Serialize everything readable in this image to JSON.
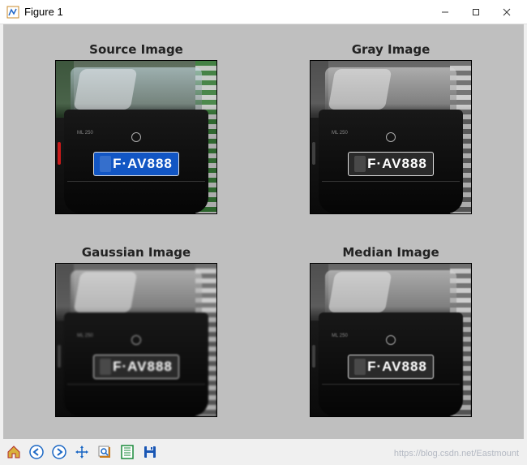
{
  "window": {
    "title": "Figure 1"
  },
  "subplots": [
    {
      "title": "Source Image",
      "mode": "color",
      "plate_text": "F·AV888",
      "badge": "ML 250"
    },
    {
      "title": "Gray Image",
      "mode": "gray",
      "plate_text": "F·AV888",
      "badge": "ML 250"
    },
    {
      "title": "Gaussian Image",
      "mode": "gauss",
      "plate_text": "F·AV888",
      "badge": "ML 250"
    },
    {
      "title": "Median Image",
      "mode": "median",
      "plate_text": "F·AV888",
      "badge": "ML 250"
    }
  ],
  "toolbar": {
    "home": "Home",
    "back": "Back",
    "forward": "Forward",
    "pan": "Pan",
    "zoom": "Zoom",
    "subplots": "Configure subplots",
    "save": "Save"
  },
  "watermark": "https://blog.csdn.net/Eastmount"
}
